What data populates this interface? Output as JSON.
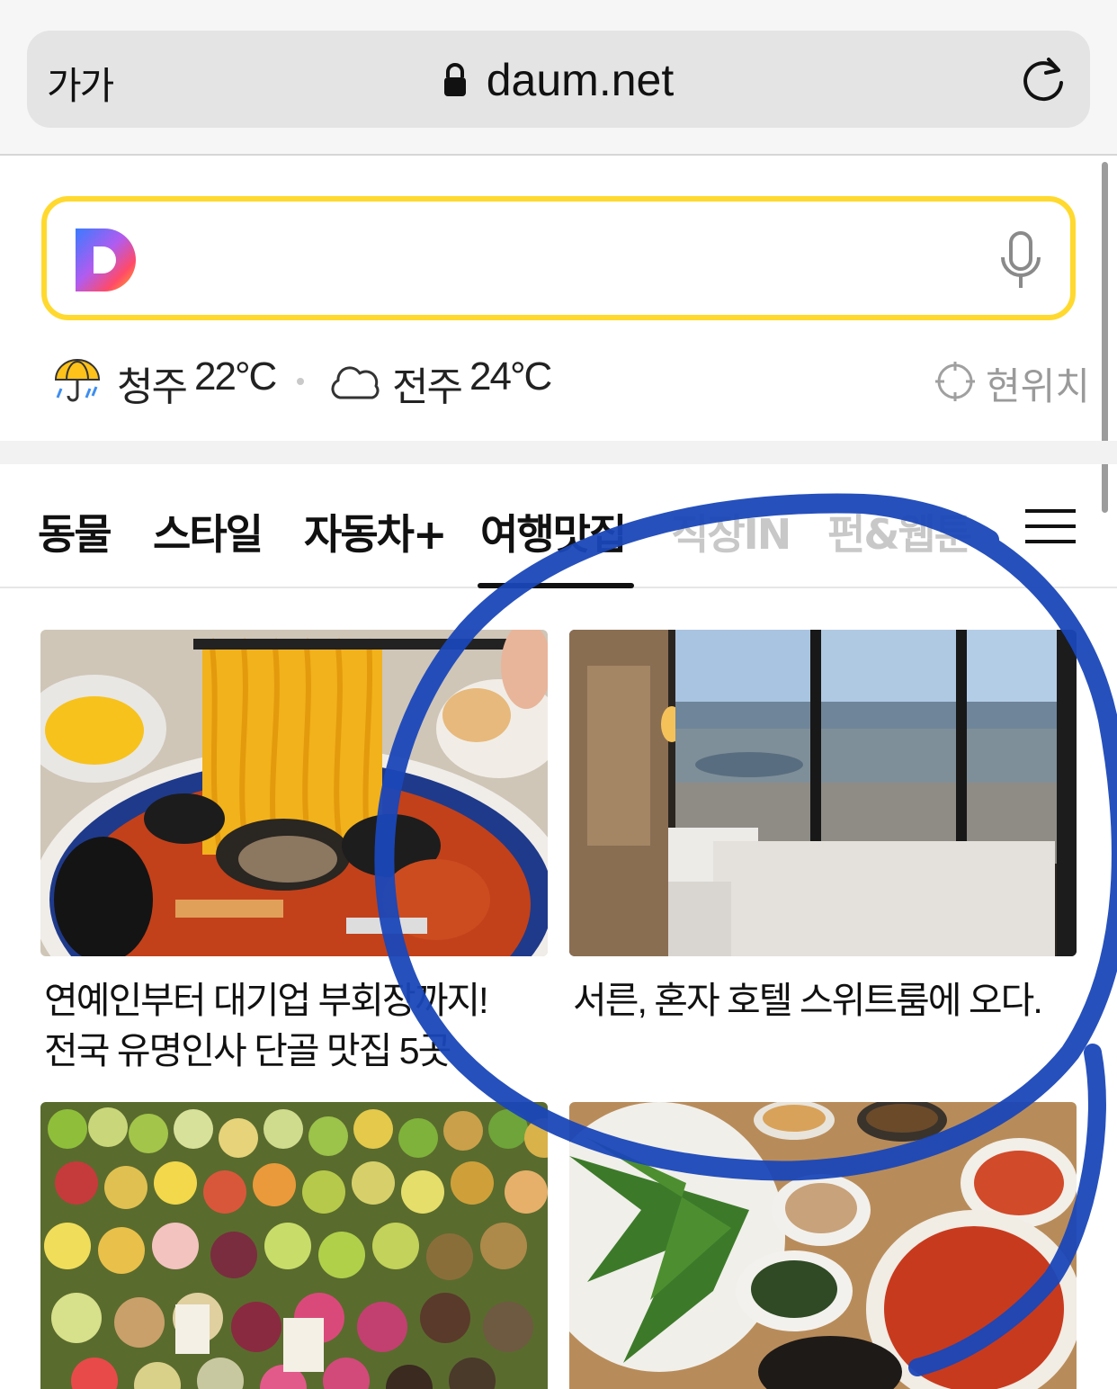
{
  "browser": {
    "text_size_label": "가가",
    "url": "daum.net"
  },
  "search": {
    "logo_letter": "D"
  },
  "weather": [
    {
      "city": "청주",
      "temp": "22°C",
      "icon": "umbrella-rain-icon"
    },
    {
      "city": "전주",
      "temp": "24°C",
      "icon": "cloud-icon"
    }
  ],
  "location_button": "현위치",
  "tabs": [
    {
      "label": "동물",
      "active": false
    },
    {
      "label": "스타일",
      "active": false
    },
    {
      "label": "자동차+",
      "active": false
    },
    {
      "label": "여행맛집",
      "active": true
    },
    {
      "label": "직장IN",
      "active": false
    },
    {
      "label": "펀&웹툰",
      "active": false
    }
  ],
  "cards": [
    {
      "title": "연예인부터 대기업 부회장까지!\n전국 유명인사 단골 맛집 5곳",
      "image": "jjamppong-noodles"
    },
    {
      "title": "서른, 혼자 호텔 스위트룸에 오다.",
      "image": "hotel-room-city-view"
    },
    {
      "title": "",
      "image": "fruit-market"
    },
    {
      "title": "",
      "image": "korean-side-dishes"
    }
  ],
  "colors": {
    "search_border": "#ffd92e",
    "annotation_pen": "#1a47b8"
  }
}
